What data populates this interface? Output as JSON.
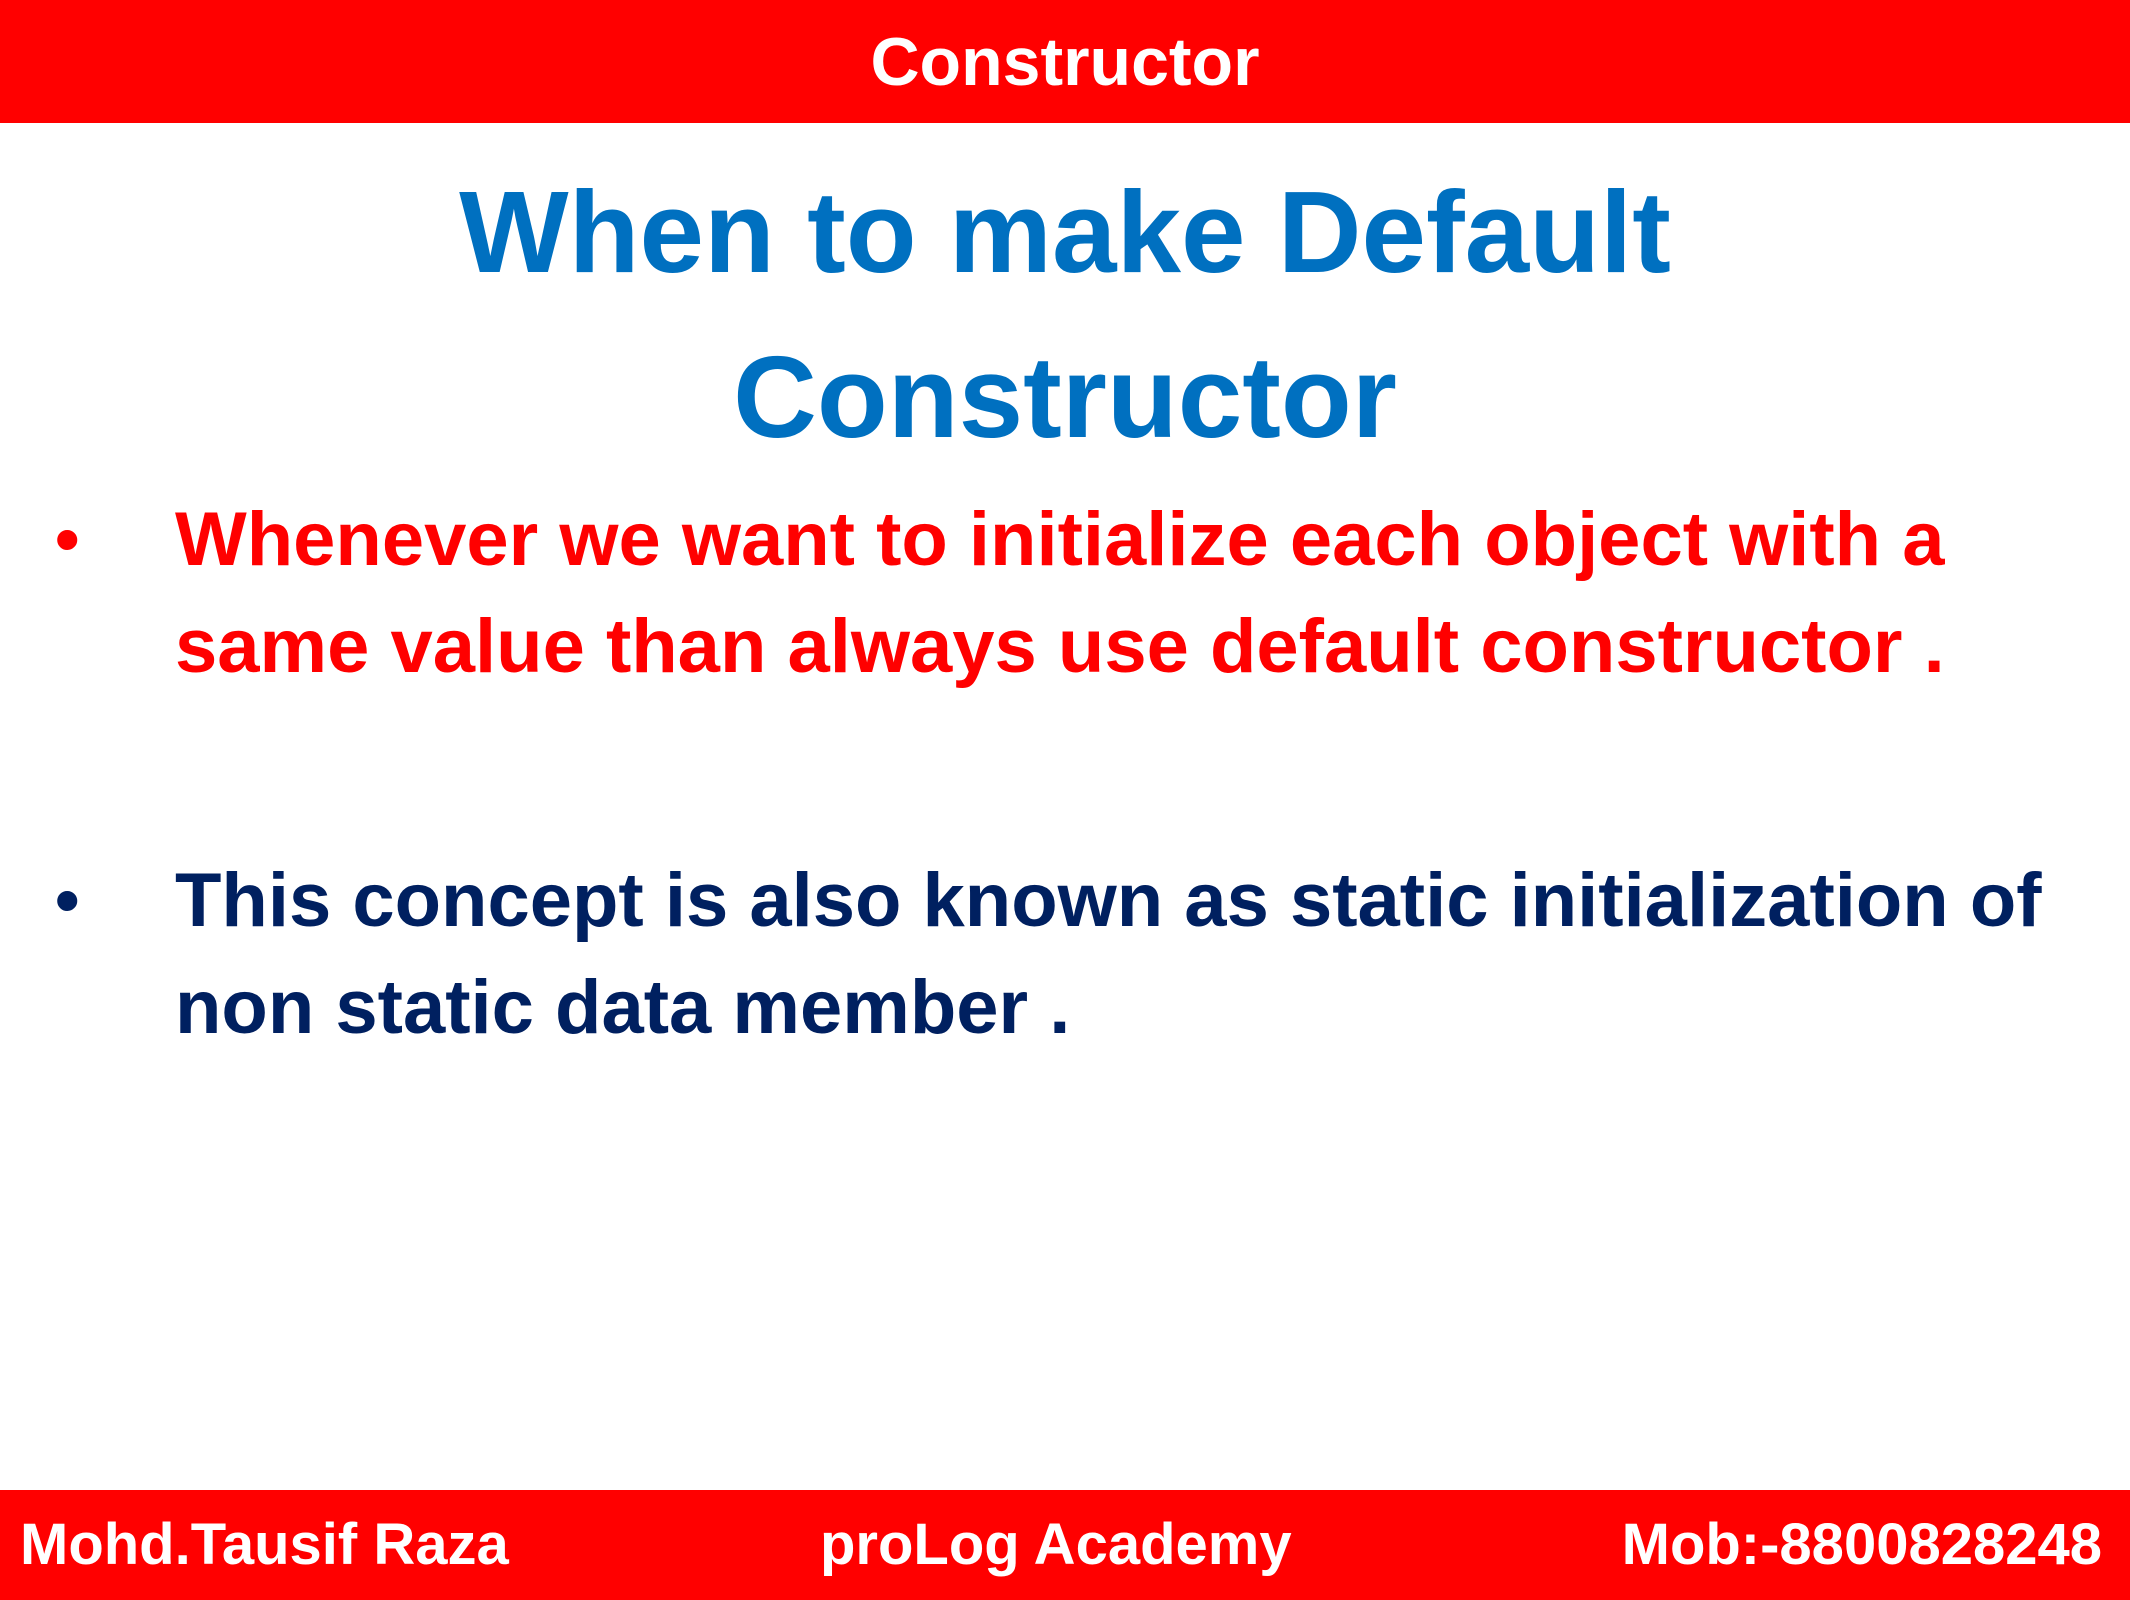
{
  "header": {
    "title": "Constructor"
  },
  "slide": {
    "heading_line1": "When to make Default",
    "heading_line2": "Constructor",
    "bullets": [
      {
        "marker": "•",
        "text": "Whenever we want to initialize each object with a same value than always use default constructor .",
        "color": "#ff0000"
      },
      {
        "marker": "•",
        "text": "This concept is also known as static initialization of non static data member .",
        "color": "#002060"
      }
    ]
  },
  "footer": {
    "author": "Mohd.Tausif Raza",
    "academy": "proLog Academy",
    "mobile": "Mob:-8800828248"
  },
  "colors": {
    "bar": "#ff0000",
    "heading": "#0070c0",
    "bullet_red": "#ff0000",
    "bullet_navy": "#002060"
  }
}
